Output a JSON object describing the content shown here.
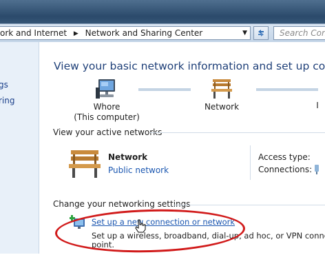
{
  "address_bar": {
    "breadcrumbs": [
      "ork and Internet",
      "Network and Sharing Center"
    ],
    "search_placeholder": "Search Con"
  },
  "nav_pane": {
    "items": [
      "gs",
      "ring"
    ]
  },
  "main": {
    "title": "View your basic network information and set up connec",
    "map": {
      "nodes": [
        {
          "label_line1": "Whore",
          "label_line2": "(This computer)",
          "icon": "computer-icon"
        },
        {
          "label_line1": "Network",
          "label_line2": "",
          "icon": "bench-network-icon"
        },
        {
          "label_line1": "I",
          "label_line2": "",
          "icon": "internet-icon"
        }
      ]
    },
    "active_networks": {
      "heading": "View your active networks",
      "network_name": "Network",
      "network_type": "Public network",
      "access_type_label": "Access type:",
      "connections_label": "Connections:"
    },
    "settings": {
      "heading": "Change your networking settings",
      "task_link": "Set up a new connection or network",
      "task_desc_line1": "Set up a wireless, broadband, dial-up, ad hoc, or VPN connectio",
      "task_desc_line2": "point."
    }
  },
  "colors": {
    "link": "#1a56b0",
    "title": "#1e3f78",
    "highlight_oval": "#d11a1a"
  }
}
